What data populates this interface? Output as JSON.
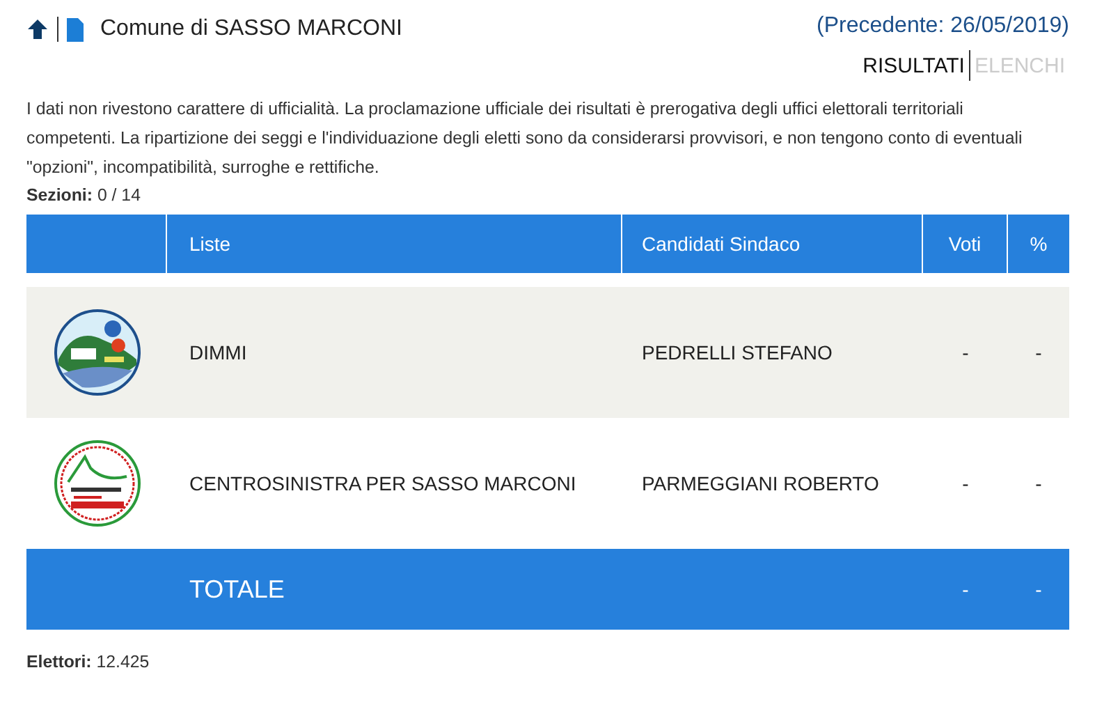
{
  "header": {
    "title": "Comune di SASSO MARCONI",
    "previous": "(Precedente: 26/05/2019)"
  },
  "tabs": [
    {
      "label": "RISULTATI",
      "selected": true
    },
    {
      "label": "ELENCHI",
      "selected": false
    }
  ],
  "disclaimer": "I dati non rivestono carattere di ufficialità. La proclamazione ufficiale dei risultati è prerogativa degli uffici elettorali territoriali competenti. La ripartizione dei seggi e l'individuazione degli eletti sono da considerarsi provvisori, e non tengono conto di eventuali \"opzioni\", incompatibilità, surroghe e rettifiche.",
  "sections": {
    "label": "Sezioni:",
    "value": "0 / 14"
  },
  "table": {
    "columns": [
      "Liste",
      "Candidati Sindaco",
      "Voti",
      "%"
    ],
    "rows": [
      {
        "kind": "hills",
        "list": "DIMMI",
        "candidate": "PEDRELLI STEFANO",
        "votes": "-",
        "percent": "-"
      },
      {
        "kind": "ring",
        "list": "CENTROSINISTRA PER SASSO MARCONI",
        "candidate": "PARMEGGIANI ROBERTO",
        "votes": "-",
        "percent": "-"
      }
    ],
    "total": {
      "label": "TOTALE",
      "votes": "-",
      "percent": "-"
    }
  },
  "voters": {
    "label": "Elettori:",
    "value": "12.425"
  }
}
